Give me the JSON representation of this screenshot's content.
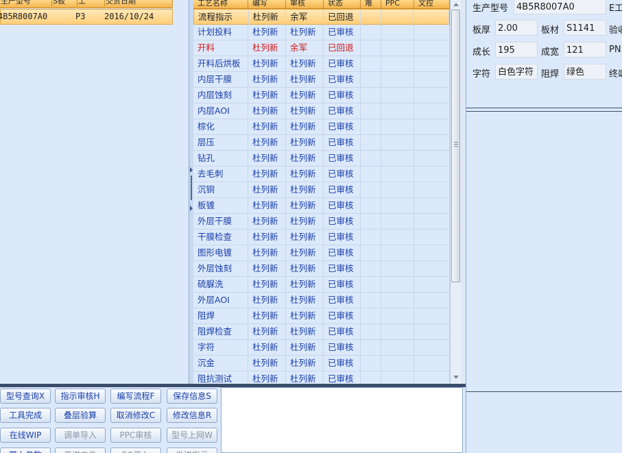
{
  "left_grid": {
    "columns": [
      "生产型号",
      "S板",
      "工",
      "交货日期"
    ],
    "selected_row": [
      "4B5R8007A0",
      "",
      "P3",
      "2016/10/24"
    ]
  },
  "process_grid": {
    "columns": [
      "工艺名称",
      "编写",
      "审核",
      "状态",
      "难",
      "PPC",
      "文控"
    ],
    "rows": [
      {
        "name": "流程指示",
        "writer": "杜列新",
        "reviewer": "余军",
        "status": "已回退",
        "style": "selected"
      },
      {
        "name": "计划投料",
        "writer": "杜列新",
        "reviewer": "杜列新",
        "status": "已审核",
        "style": ""
      },
      {
        "name": "开料",
        "writer": "杜列新",
        "reviewer": "余军",
        "status": "已回退",
        "style": "red"
      },
      {
        "name": "开料后烘板",
        "writer": "杜列新",
        "reviewer": "杜列新",
        "status": "已审核",
        "style": ""
      },
      {
        "name": "内层干膜",
        "writer": "杜列新",
        "reviewer": "杜列新",
        "status": "已审核",
        "style": ""
      },
      {
        "name": "内层蚀刻",
        "writer": "杜列新",
        "reviewer": "杜列新",
        "status": "已审核",
        "style": ""
      },
      {
        "name": "内层AOI",
        "writer": "杜列新",
        "reviewer": "杜列新",
        "status": "已审核",
        "style": ""
      },
      {
        "name": "棕化",
        "writer": "杜列新",
        "reviewer": "杜列新",
        "status": "已审核",
        "style": ""
      },
      {
        "name": "层压",
        "writer": "杜列新",
        "reviewer": "杜列新",
        "status": "已审核",
        "style": ""
      },
      {
        "name": "钻孔",
        "writer": "杜列新",
        "reviewer": "杜列新",
        "status": "已审核",
        "style": ""
      },
      {
        "name": "去毛刺",
        "writer": "杜列新",
        "reviewer": "杜列新",
        "status": "已审核",
        "style": ""
      },
      {
        "name": "沉铜",
        "writer": "杜列新",
        "reviewer": "杜列新",
        "status": "已审核",
        "style": ""
      },
      {
        "name": "板镀",
        "writer": "杜列新",
        "reviewer": "杜列新",
        "status": "已审核",
        "style": ""
      },
      {
        "name": "外层干膜",
        "writer": "杜列新",
        "reviewer": "杜列新",
        "status": "已审核",
        "style": ""
      },
      {
        "name": "干膜检查",
        "writer": "杜列新",
        "reviewer": "杜列新",
        "status": "已审核",
        "style": ""
      },
      {
        "name": "图形电镀",
        "writer": "杜列新",
        "reviewer": "杜列新",
        "status": "已审核",
        "style": ""
      },
      {
        "name": "外层蚀刻",
        "writer": "杜列新",
        "reviewer": "杜列新",
        "status": "已审核",
        "style": ""
      },
      {
        "name": "硫脲洗",
        "writer": "杜列新",
        "reviewer": "杜列新",
        "status": "已审核",
        "style": ""
      },
      {
        "name": "外层AOI",
        "writer": "杜列新",
        "reviewer": "杜列新",
        "status": "已审核",
        "style": ""
      },
      {
        "name": "阻焊",
        "writer": "杜列新",
        "reviewer": "杜列新",
        "status": "已审核",
        "style": ""
      },
      {
        "name": "阻焊检查",
        "writer": "杜列新",
        "reviewer": "杜列新",
        "status": "已审核",
        "style": ""
      },
      {
        "name": "字符",
        "writer": "杜列新",
        "reviewer": "杜列新",
        "status": "已审核",
        "style": ""
      },
      {
        "name": "沉金",
        "writer": "杜列新",
        "reviewer": "杜列新",
        "status": "已审核",
        "style": ""
      },
      {
        "name": "阻抗测试",
        "writer": "杜列新",
        "reviewer": "杜列新",
        "status": "已审核",
        "style": ""
      }
    ]
  },
  "info_panel": {
    "model_label": "生产型号",
    "model_value": "4B5R8007A0",
    "model_trailing": "E工",
    "thickness_label": "板厚",
    "thickness_value": "2.00",
    "material_label": "板材",
    "material_value": "S1141",
    "material_trailing": "验收",
    "length_label": "成长",
    "length_value": "195",
    "width_label": "成宽",
    "width_value": "121",
    "width_trailing": "PN",
    "char_label": "字符",
    "char_value": "白色字符",
    "mask_label": "阻焊",
    "mask_value": "绿色",
    "mask_trailing": "终端"
  },
  "buttons": {
    "row1": [
      "型号查询X",
      "指示审核H",
      "编写流程F",
      "保存信息S"
    ],
    "row2": [
      "工具完成",
      "叠层验算",
      "取消修改C",
      "修改信息R"
    ],
    "row3": [
      "在线WIP",
      "调单导入",
      "PPC审核",
      "型号上网W"
    ],
    "row4": [
      "带上参数",
      "传送文件",
      "EQ录入",
      "发送指示"
    ]
  }
}
